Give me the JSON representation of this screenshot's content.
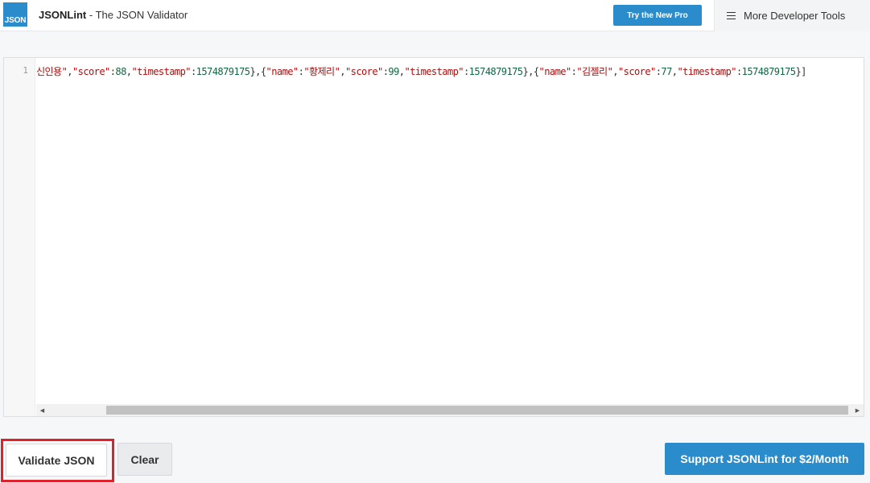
{
  "header": {
    "logo_text": "JSON",
    "brand_name": "JSONLint",
    "brand_separator": " - ",
    "brand_tagline": "The JSON Validator",
    "pro_button": "Try the New Pro",
    "more_tools": "More Developer Tools"
  },
  "editor": {
    "line_number": "1",
    "tokens": [
      {
        "t": "신인용\"",
        "c": "str"
      },
      {
        "t": ",",
        "c": "p"
      },
      {
        "t": "\"score\"",
        "c": "key"
      },
      {
        "t": ":",
        "c": "p"
      },
      {
        "t": "88",
        "c": "num"
      },
      {
        "t": ",",
        "c": "p"
      },
      {
        "t": "\"timestamp\"",
        "c": "key"
      },
      {
        "t": ":",
        "c": "p"
      },
      {
        "t": "1574879175",
        "c": "num"
      },
      {
        "t": "},{",
        "c": "p"
      },
      {
        "t": "\"name\"",
        "c": "key"
      },
      {
        "t": ":",
        "c": "p"
      },
      {
        "t": "\"황제리\"",
        "c": "str"
      },
      {
        "t": ",",
        "c": "p"
      },
      {
        "t": "\"score\"",
        "c": "key"
      },
      {
        "t": ":",
        "c": "p"
      },
      {
        "t": "99",
        "c": "num"
      },
      {
        "t": ",",
        "c": "p"
      },
      {
        "t": "\"timestamp\"",
        "c": "key"
      },
      {
        "t": ":",
        "c": "p"
      },
      {
        "t": "1574879175",
        "c": "num"
      },
      {
        "t": "},{",
        "c": "p"
      },
      {
        "t": "\"name\"",
        "c": "key"
      },
      {
        "t": ":",
        "c": "p"
      },
      {
        "t": "\"김젤리\"",
        "c": "str"
      },
      {
        "t": ",",
        "c": "p"
      },
      {
        "t": "\"score\"",
        "c": "key"
      },
      {
        "t": ":",
        "c": "p"
      },
      {
        "t": "77",
        "c": "num"
      },
      {
        "t": ",",
        "c": "p"
      },
      {
        "t": "\"timestamp\"",
        "c": "key"
      },
      {
        "t": ":",
        "c": "p"
      },
      {
        "t": "1574879175",
        "c": "num"
      },
      {
        "t": "}]",
        "c": "p"
      }
    ],
    "scroll_left_glyph": "◀",
    "scroll_right_glyph": "▶"
  },
  "actions": {
    "validate": "Validate JSON",
    "clear": "Clear",
    "support": "Support JSONLint for $2/Month"
  },
  "colors": {
    "accent": "#2a8ccb",
    "highlight": "#e0202a",
    "string": "#aa1111",
    "number": "#116644"
  }
}
